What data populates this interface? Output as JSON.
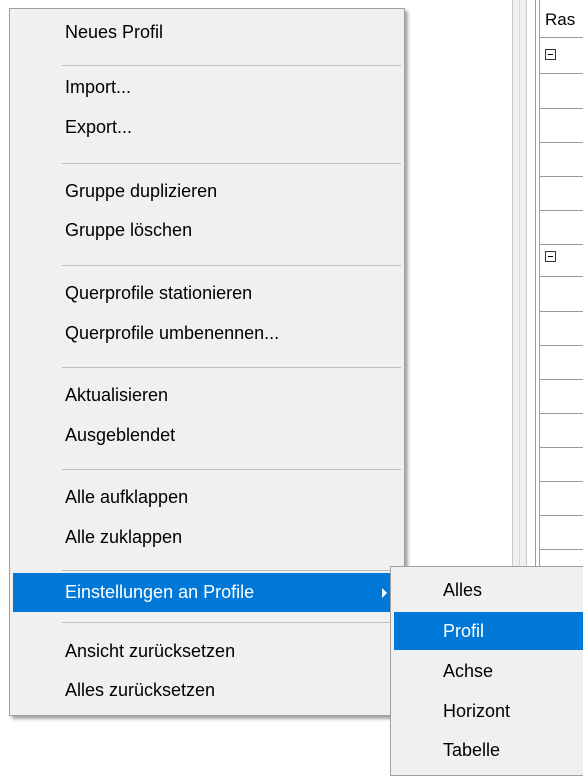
{
  "grid": {
    "header_label": "Ras"
  },
  "context_menu": {
    "items": [
      {
        "label": "Neues Profil"
      },
      {
        "label": "Import..."
      },
      {
        "label": "Export..."
      },
      {
        "label": "Gruppe duplizieren"
      },
      {
        "label": "Gruppe löschen"
      },
      {
        "label": "Querprofile stationieren"
      },
      {
        "label": "Querprofile umbenennen..."
      },
      {
        "label": "Aktualisieren"
      },
      {
        "label": "Ausgeblendet"
      },
      {
        "label": "Alle aufklappen"
      },
      {
        "label": "Alle zuklappen"
      },
      {
        "label": "Einstellungen an Profile",
        "selected": true,
        "has_submenu": true
      },
      {
        "label": "Ansicht zurücksetzen"
      },
      {
        "label": "Alles zurücksetzen"
      }
    ],
    "accent_color": "#0078d7"
  },
  "submenu": {
    "items": [
      {
        "label": "Alles"
      },
      {
        "label": "Profil",
        "selected": true
      },
      {
        "label": "Achse"
      },
      {
        "label": "Horizont"
      },
      {
        "label": "Tabelle"
      }
    ]
  }
}
